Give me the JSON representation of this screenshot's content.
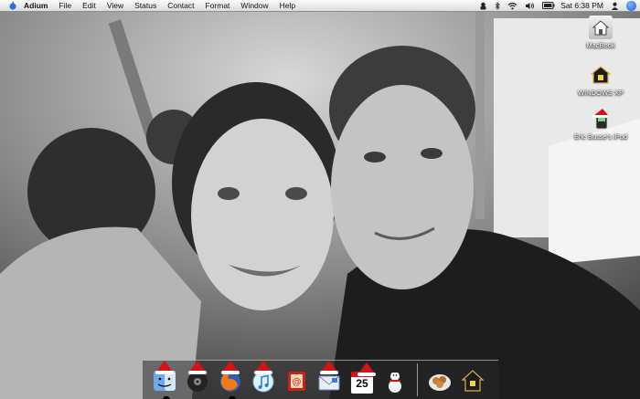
{
  "menubar": {
    "app_name": "Adium",
    "menus": [
      "File",
      "Edit",
      "View",
      "Status",
      "Contact",
      "Format",
      "Window",
      "Help"
    ],
    "clock": "Sat 6:38 PM"
  },
  "desktop_icons": [
    {
      "label": "MacBook",
      "icon": "house-hd-icon"
    },
    {
      "label": "WINDOWS XP",
      "icon": "house-drive-icon"
    },
    {
      "label": "Eric Busse's iPod",
      "icon": "ipod-santa-hat-icon"
    }
  ],
  "dock": {
    "calendar_day": "25",
    "items": [
      "finder-icon",
      "dvd-player-icon",
      "firefox-icon",
      "itunes-icon",
      "contacts-icon",
      "mail-icon",
      "ical-icon",
      "snowman-icon",
      "cookie-plate-icon",
      "house-icon"
    ]
  },
  "colors": {
    "hat_red": "#d0141a",
    "menubar_bg": "#ececec"
  }
}
